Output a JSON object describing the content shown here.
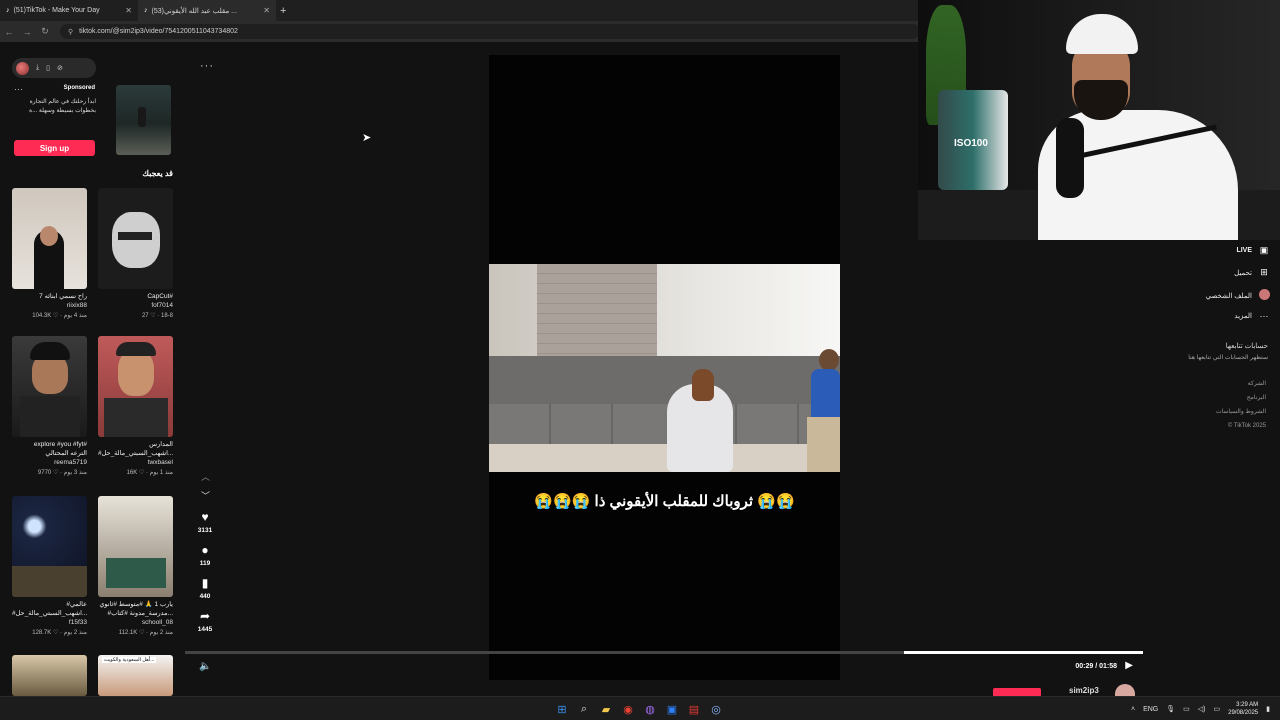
{
  "browser": {
    "tabs": [
      {
        "title": "(51)TikTok - Make Your Day",
        "active": false
      },
      {
        "title": "(53)مقلب عبد الله الأيقوني ...",
        "active": true
      }
    ],
    "new_tab_icon": "+",
    "url": "tiktok.com/@sim2ip3/video/7541200511043734802"
  },
  "left": {
    "ad": {
      "dots": "···",
      "sponsored": "Sponsored",
      "text": "ابدأ رحلتك في عالم التجارة بخطوات بسيطة وسهلة",
      "text_tail": "...ة",
      "signup": "Sign up"
    },
    "section_title": "قد يعجبك",
    "cards": [
      {
        "caption": "راح نسمي ابنائه 7",
        "user": "riixix88",
        "meta": "104.3K ♡ · منذ 4 يوم"
      },
      {
        "caption": "CapCut#",
        "user": "fof7014",
        "meta": "27 ♡ · 18-8"
      },
      {
        "caption": "explore #you #fyt#",
        "caption2": "الترعه المحتالي",
        "user": "reema5719",
        "meta": "9770 ♡ · منذ 3 يوم"
      },
      {
        "caption": "المدارس",
        "caption2": "#اشهب_السبتي_مالة_حل...",
        "user": "twxbasel",
        "meta": "16K ♡ · منذ 1 يوم"
      },
      {
        "caption": "#عالمي",
        "caption2": "#اشهب_السبتي_مالة_حل...",
        "user": "f15f33",
        "meta": "128.7K ♡ · منذ 2 يوم"
      },
      {
        "caption": "يارب 1 🙏 #متوسط #ثانوي",
        "caption2": "#مدرسة_مدونة #كتاب...",
        "user": "schooll_08",
        "meta": "112.1K ♡ · منذ 2 يوم"
      },
      {
        "caption": "",
        "user": "",
        "meta": ""
      },
      {
        "caption": "أهل السعودية والكويت...",
        "user": "",
        "meta": ""
      }
    ]
  },
  "player": {
    "subtitle": "😭😭😭 ثروباك للمقلب الأيقوني ذا 😭😭",
    "likes": "3131",
    "comments": "119",
    "saves": "440",
    "shares": "1445",
    "time": "00:29 / 01:58",
    "progress_pct": 0.25
  },
  "right_nav": {
    "live": "LIVE",
    "upload": "تحميل",
    "profile": "الملف الشخصي",
    "more": "المزيد",
    "following_title": "حسابات تتابعها",
    "following_sub": "ستظهر الحسابات التي تتابعها هنا",
    "footer": [
      "الشركة",
      "البرنامج",
      "الشروط والسياسات",
      "© TikTok 2025"
    ]
  },
  "webcam": {
    "bottle_label": "ISO100"
  },
  "bottom": {
    "user": "sim2ip3"
  },
  "taskbar": {
    "lang": "ENG",
    "time": "3:29 AM",
    "date": "29/08/2025"
  },
  "icons": {
    "heart": "♥",
    "comment": "●",
    "bookmark": "▮",
    "share": "➦",
    "volume": "🔈",
    "play": "▶"
  },
  "colors": {
    "accent": "#fe2c55",
    "bg": "#121212"
  }
}
